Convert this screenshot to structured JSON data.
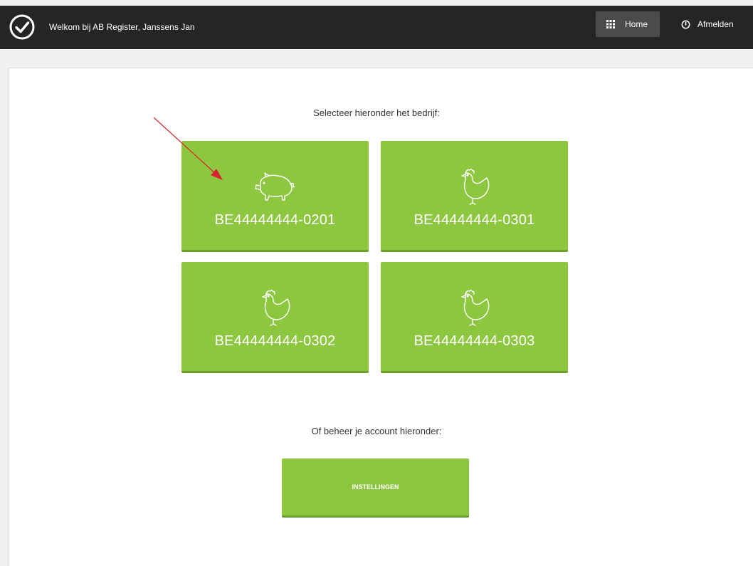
{
  "header": {
    "welcome_text": "Welkom bij AB Register, Janssens Jan",
    "home_label": "Home",
    "logout_label": "Afmelden"
  },
  "main": {
    "select_heading": "Selecteer hieronder het bedrijf:",
    "companies": [
      {
        "code": "BE44444444-0201",
        "icon": "pig-icon"
      },
      {
        "code": "BE44444444-0301",
        "icon": "chicken-icon"
      },
      {
        "code": "BE44444444-0302",
        "icon": "chicken-icon"
      },
      {
        "code": "BE44444444-0303",
        "icon": "chicken-icon"
      }
    ],
    "account_heading": "Of beheer je account hieronder:",
    "settings_label": "INSTELLINGEN"
  },
  "colors": {
    "tile_green": "#8dc63f",
    "header_dark": "#252525",
    "annotation_red": "#d9232e"
  }
}
